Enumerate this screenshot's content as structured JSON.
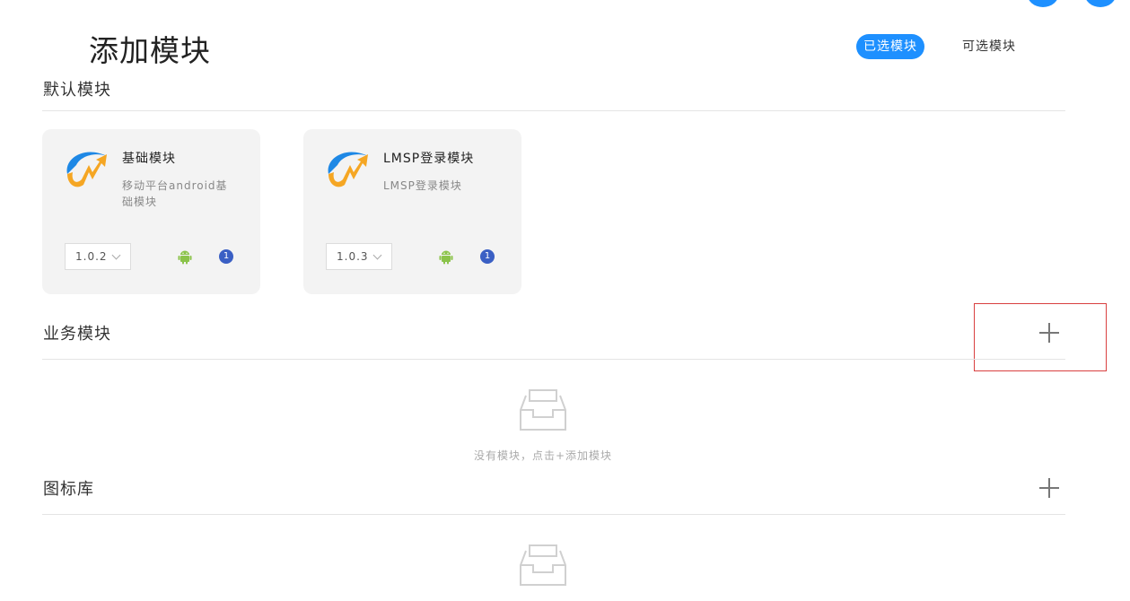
{
  "page": {
    "title": "添加模块",
    "tabs": [
      {
        "label": "已选模块",
        "selected": true
      },
      {
        "label": "可选模块",
        "selected": false
      }
    ]
  },
  "sections": {
    "default": {
      "title": "默认模块",
      "cards": [
        {
          "name": "基础模块",
          "description": "移动平台android基础模块",
          "version": "1.0.2",
          "platform_icon": "android-icon",
          "count": "1"
        },
        {
          "name": "LMSP登录模块",
          "description": "LMSP登录模块",
          "version": "1.0.3",
          "platform_icon": "android-icon",
          "count": "1"
        }
      ]
    },
    "business": {
      "title": "业务模块",
      "empty_text": "没有模块，点击+添加模块"
    },
    "icons": {
      "title": "图标库"
    }
  },
  "colors": {
    "accent": "#1e90ff",
    "card_bg": "#f3f3f3",
    "badge": "#3a5fc4",
    "android": "#8bc34a",
    "highlight": "#d94040"
  }
}
